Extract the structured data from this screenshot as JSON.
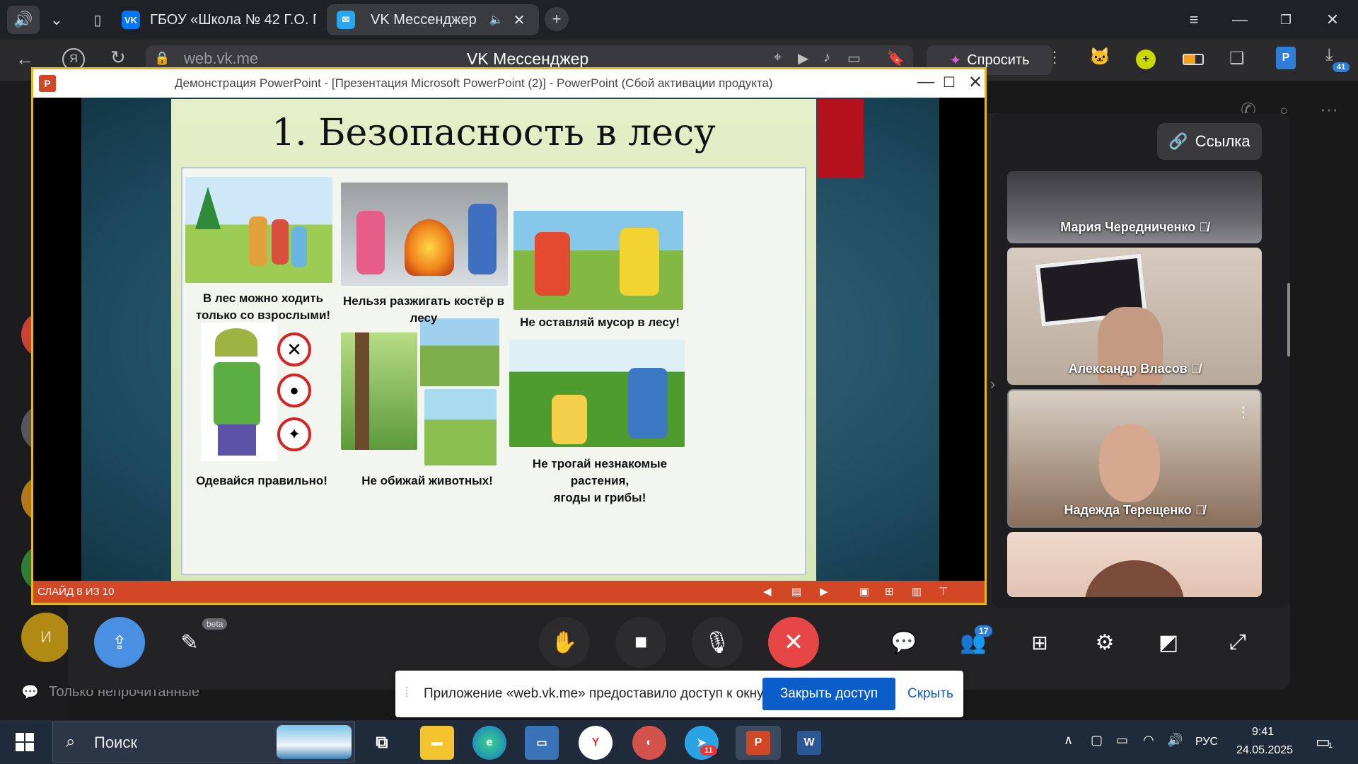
{
  "browser": {
    "tabs": [
      {
        "title": "ГБОУ «Школа № 42 Г.О. Г",
        "icon_text": "VK"
      },
      {
        "title": "VK Мессенджер"
      }
    ],
    "url": "web.vk.me",
    "page_title": "VK Мессенджер",
    "ask_label": "Спросить",
    "downloads_count": "41"
  },
  "sidebar": {
    "link_button": "Ссылка",
    "participants": [
      {
        "name": "Мария Чередниченко"
      },
      {
        "name": "Александр Власов"
      },
      {
        "name": "Надежда Терещенко"
      },
      {
        "name": ""
      }
    ]
  },
  "left": {
    "only_unread": "Только непрочитанные",
    "avatar_letter": "И"
  },
  "powerpoint": {
    "window_title": "Демонстрация PowerPoint - [Презентация Microsoft PowerPoint (2)] - PowerPoint (Сбой активации продукта)",
    "status": "СЛАЙД 8 ИЗ 10",
    "slide": {
      "title": "1. Безопасность в лесу",
      "captions": [
        "В лес можно ходить\nтолько со взрослыми!",
        "Нельзя разжигать костёр в лесу",
        "Не оставляй мусор в лесу!",
        "Одевайся правильно!",
        "Не обижай животных!",
        "Не трогай незнакомые\nрастения,\nягоды и грибы!"
      ]
    }
  },
  "controls": {
    "beta": "beta",
    "participants_count": "17"
  },
  "share_banner": {
    "message": "Приложение «web.vk.me» предоставило доступ к окну.",
    "stop": "Закрыть доступ",
    "hide": "Скрыть"
  },
  "taskbar": {
    "search": "Поиск",
    "lang": "РУС",
    "time": "9:41",
    "date": "24.05.2025",
    "notifications": "1",
    "telegram_badge": "11"
  }
}
